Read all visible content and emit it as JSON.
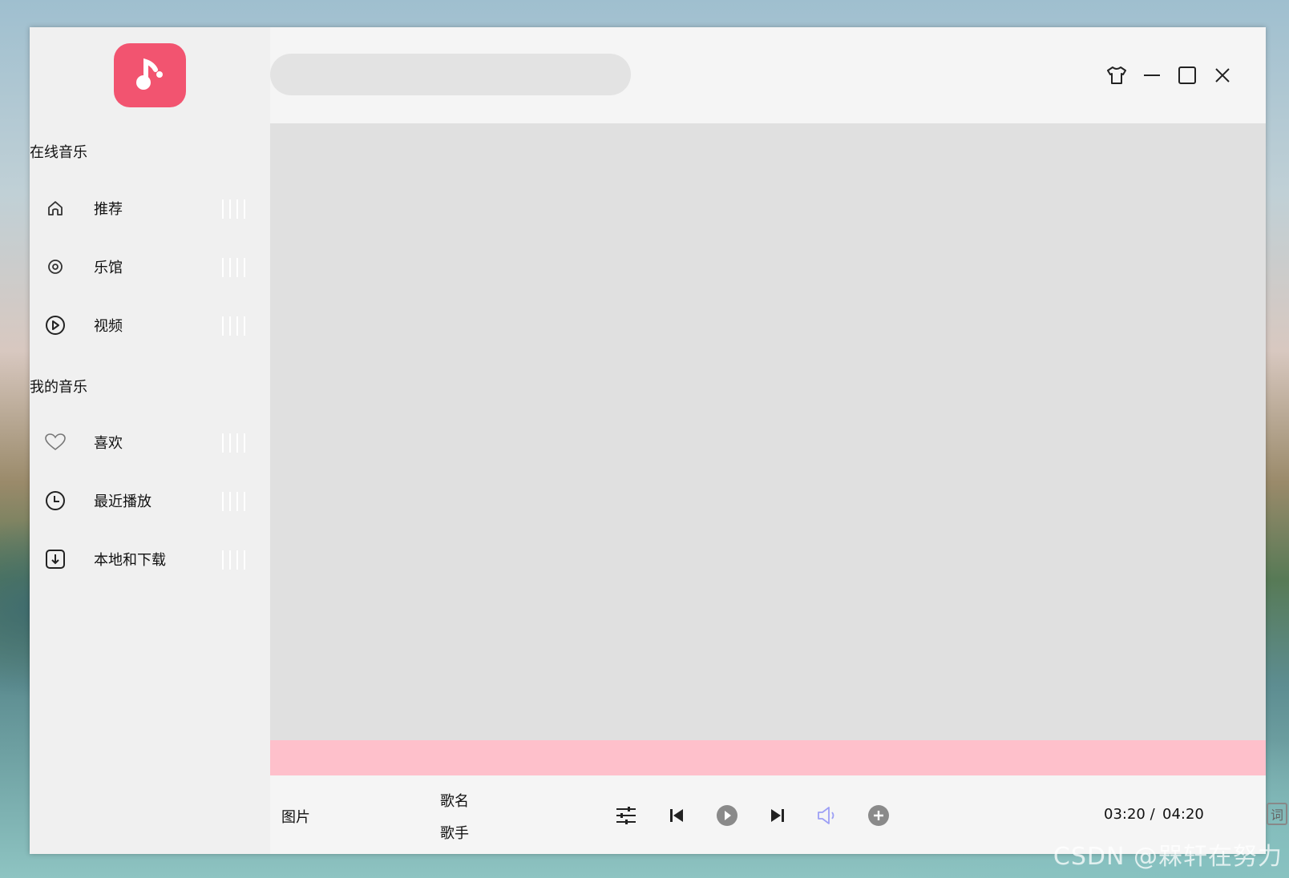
{
  "sidebar": {
    "section_online": "在线音乐",
    "online_items": [
      {
        "label": "推荐",
        "icon": "home-icon"
      },
      {
        "label": "乐馆",
        "icon": "disc-icon"
      },
      {
        "label": "视频",
        "icon": "play-circle-icon"
      }
    ],
    "section_mine": "我的音乐",
    "mine_items": [
      {
        "label": "喜欢",
        "icon": "heart-icon"
      },
      {
        "label": "最近播放",
        "icon": "clock-icon"
      },
      {
        "label": "本地和下载",
        "icon": "download-icon"
      }
    ]
  },
  "search": {
    "placeholder": ""
  },
  "player": {
    "image_label": "图片",
    "song_name": "歌名",
    "singer": "歌手",
    "current_time": "03:20 /",
    "total_time": "04:20",
    "lyrics_label": "词"
  },
  "watermark": "CSDN @槑轩在努力",
  "colors": {
    "accent": "#f25470",
    "progress_bar": "#fec0cb",
    "content_bg": "#e0e0e0",
    "sidebar_bg": "#f0f0f0"
  }
}
